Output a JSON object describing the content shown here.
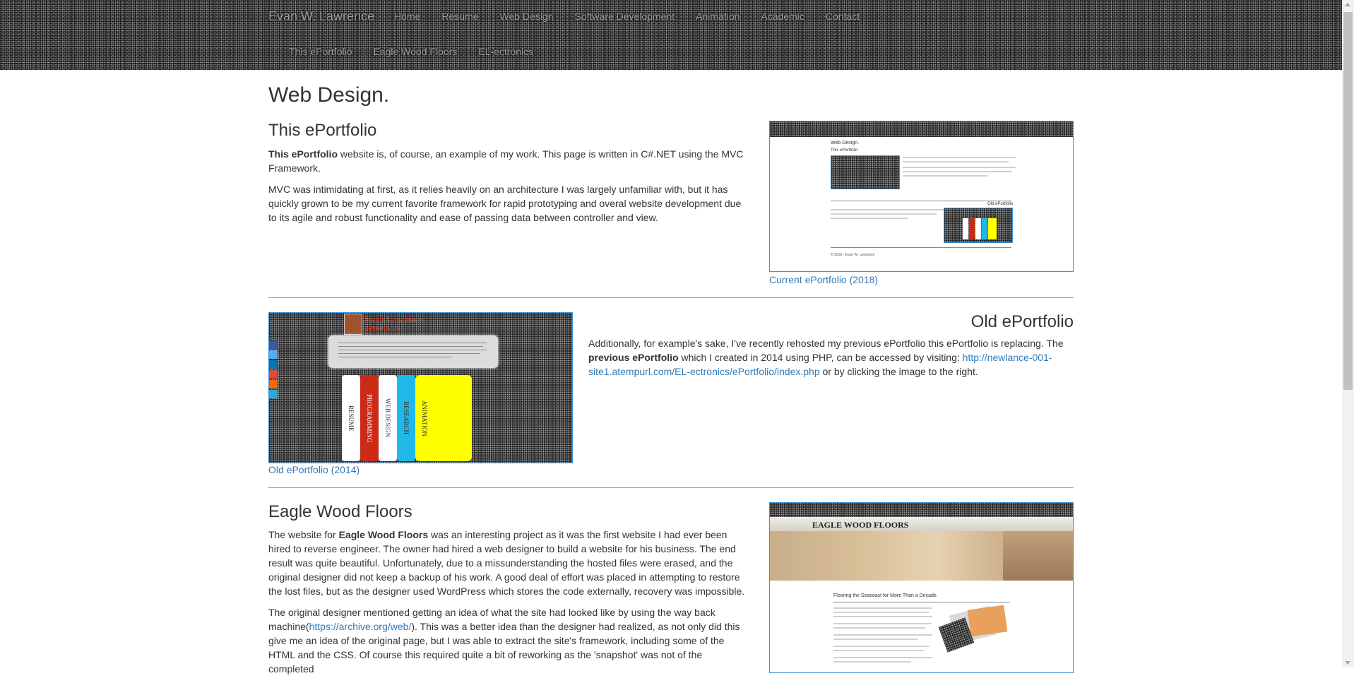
{
  "navbar": {
    "brand": "Evan W. Lawrence",
    "items": [
      "Home",
      "Resume",
      "Web Design",
      "Software Development",
      "Animation",
      "Academic",
      "Contact"
    ],
    "subitems": [
      "This ePortfolio",
      "Eagle Wood Floors",
      "EL-ectronics"
    ]
  },
  "page": {
    "title": "Web Design."
  },
  "sections": {
    "eportfolio": {
      "heading": "This ePortfolio",
      "p1_bold": "This ePortfolio",
      "p1_rest": " website is, of course, an example of my work. This page is written in C#.NET using the MVC Framework.",
      "p2": "MVC was intimidating at first, as it relies heavily on an architecture I was largely unfamiliar with, but it has quickly grown to be my current favorite framework for rapid prototyping and overal website development due to its agile and robust functionality and ease of passing data between controller and view.",
      "caption": "Current ePortfolio (2018)",
      "thumb_title": "Web Design.",
      "thumb_heading": "This ePortfolio",
      "thumb_old": "Old ePortfolio",
      "thumb_footer": "© 2018 - Evan W. Lawrence"
    },
    "old_eportfolio": {
      "heading": "Old ePortfolio",
      "text_a": "Additionally, for example's sake, I've recently rehosted my previous ePortfolio this ePortfolio is replacing. The ",
      "text_bold": "previous ePortfolio",
      "text_b": " which I created in 2014 using PHP, can be accessed by visiting: ",
      "link": "http://newlance-001-site1.atempurl.com/EL-ectronics/ePortfolio/index.php",
      "text_c": " or by clicking the image to the right.",
      "caption": "Old ePortfolio (2014)",
      "thumb_name": "Evan Lawrence",
      "thumb_sub": "ePortfolio",
      "thumb_tabs": [
        "RESUME",
        "PROGRAMMING",
        "WEB DESIGN",
        "RESEARCH",
        "ANIMATION"
      ],
      "tab_colors": [
        "#ffffff",
        "#cc2a16",
        "#ffffff",
        "#1fb8e8",
        "#ffff00"
      ]
    },
    "eagle": {
      "heading": "Eagle Wood Floors",
      "p1_a": "The website for ",
      "p1_bold": "Eagle Wood Floors",
      "p1_b": " was an interesting project as it was the first website I had ever been hired to reverse engineer. The owner had hired a web designer to build a website for his business. The end result was quite beautiful. Unfortunately, due to a missunderstanding the hosted files were erased, and the original designer did not keep a backup of his work. A good deal of effort was placed in attempting to restore the lost files, but as the designer used WordPress which stores the code externally, recovery was impossible.",
      "p2_a": "The original designer mentioned getting an idea of what the site had looked like by using the way back machine(",
      "p2_link": "https://archive.org/web/",
      "p2_b": "). This was a better idea than the designer had realized, as not only did this give me an idea of the original page, but I was able to extract the site's framework, including some of the HTML and the CSS. Of course this required quite a bit of reworking as the 'snapshot' was not of the completed",
      "thumb_logo": "EAGLE WOOD FLOORS",
      "thumb_headline": "Flooring the Seacoast for More Than a Decade."
    }
  }
}
